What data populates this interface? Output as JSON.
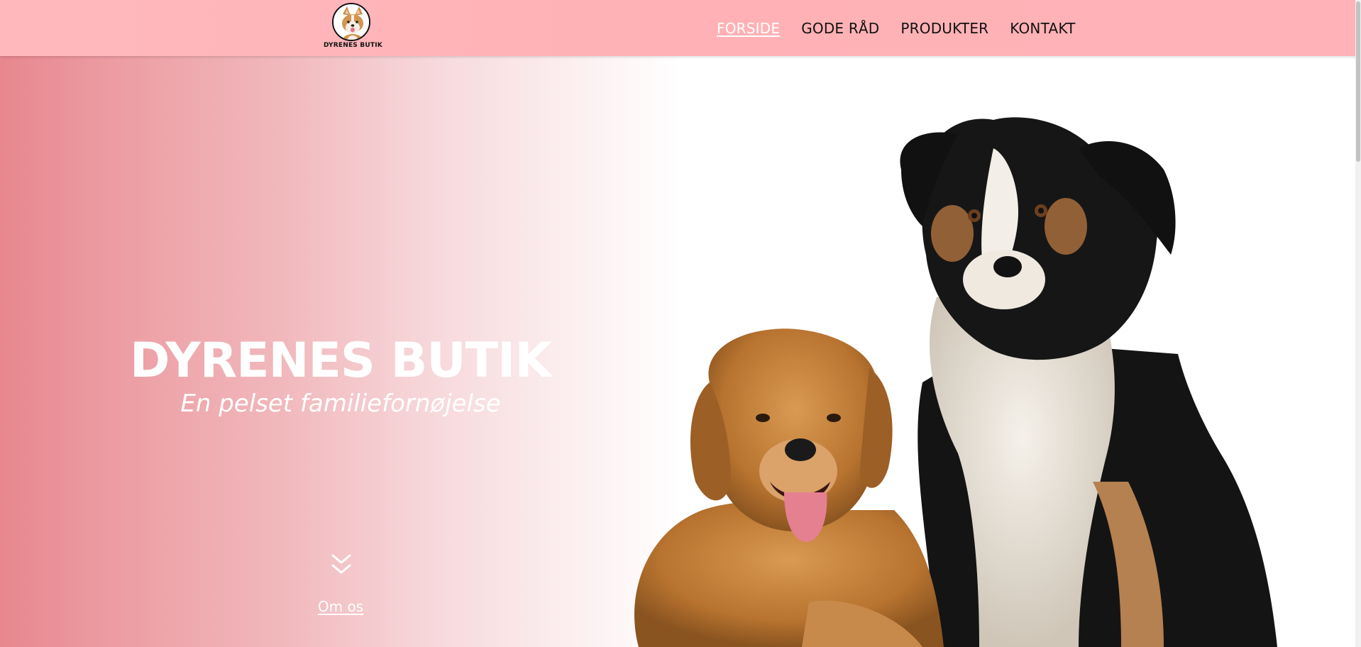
{
  "header": {
    "logo_text": "DYRENES BUTIK",
    "nav": [
      {
        "label": "FORSIDE",
        "active": true
      },
      {
        "label": "GODE RÅD",
        "active": false
      },
      {
        "label": "PRODUKTER",
        "active": false
      },
      {
        "label": "KONTAKT",
        "active": false
      }
    ]
  },
  "hero": {
    "title": "DYRENES BUTIK",
    "subtitle": "En pelset familiefornøjelse",
    "scroll_icon": "double-chevron-down-icon",
    "about_link": "Om os"
  },
  "colors": {
    "header_bg": "#ffb3b8",
    "gradient_start": "#e8878e",
    "text_light": "#ffffff",
    "nav_text": "#111111"
  }
}
